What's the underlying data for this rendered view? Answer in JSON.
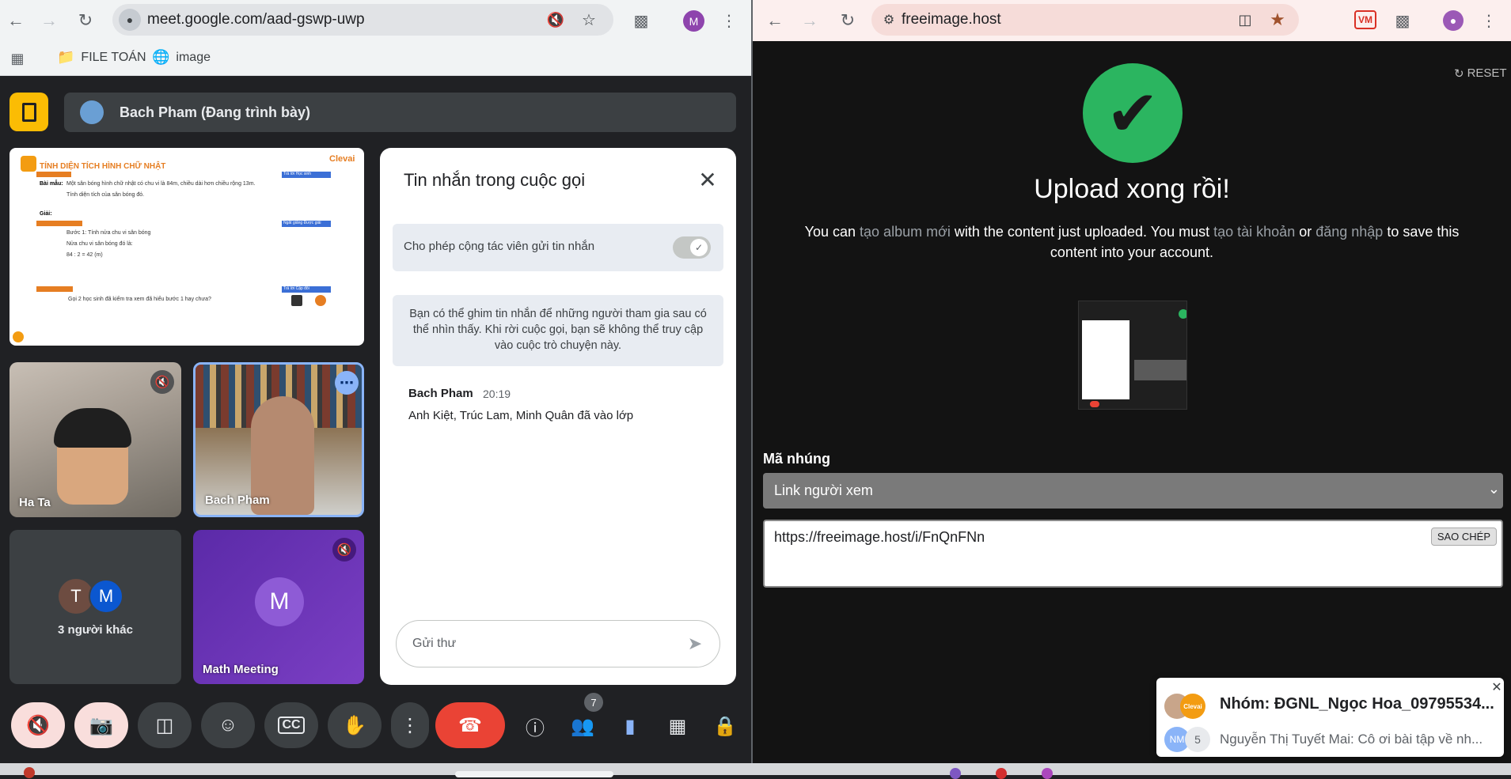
{
  "left_browser": {
    "url": "meet.google.com/aad-gswp-uwp",
    "profile_letter": "M",
    "bookmarks": [
      {
        "label": "FILE TOÁN",
        "icon": "folder-icon"
      },
      {
        "label": "image",
        "icon": "globe-icon"
      }
    ]
  },
  "meet": {
    "presenter_label": "Bach Pham (Đang trình bày)",
    "slide": {
      "brand": "Clevai",
      "title": "TÍNH DIỆN TÍCH HÌNH CHỮ NHẬT",
      "tag1": "Bài mẫu:",
      "text1": "Một sân bóng hình chữ nhật có chu vi là 84m, chiều dài hơn chiều rộng 13m.",
      "text1b": "Tính diện tích của sân bóng đó.",
      "label_solve": "Giải:",
      "step1": "Bước 1: Tính nửa chu vi sân bóng",
      "step2": "Nửa chu vi sân bóng đó là:",
      "step3": "84 : 2 = 42 (m)",
      "question": "Gọi 2 học sinh đã kiểm tra xem đã hiểu bước 1 hay chưa?",
      "side1": "Trả lời Học sinh",
      "side2": "Ngắt giảng Được giải",
      "side3": "Trả lời Cặp đôi"
    },
    "tiles": [
      {
        "name": "Ha Ta"
      },
      {
        "name": "Bach Pham"
      },
      {
        "name": "3 người khác",
        "initials": [
          "T",
          "M"
        ]
      },
      {
        "name": "Math Meeting",
        "initial": "M"
      }
    ],
    "chat": {
      "title": "Tin nhắn trong cuộc gọi",
      "toggle_label": "Cho phép cộng tác viên gửi tin nhắn",
      "info": "Bạn có thể ghim tin nhắn để những người tham gia sau có thể nhìn thấy. Khi rời cuộc gọi, bạn sẽ không thể truy cập vào cuộc trò chuyện này.",
      "message_sender": "Bach Pham",
      "message_time": "20:19",
      "message_text": "Anh Kiệt, Trúc Lam, Minh Quân đã vào lớp",
      "input_placeholder": "Gửi thư"
    },
    "participants_badge": "7"
  },
  "right_browser": {
    "url": "freeimage.host",
    "reset_label": "RESET",
    "upload_title": "Upload xong rồi!",
    "desc_before": "You can ",
    "desc_link1": "tạo album mới",
    "desc_mid1": " with the content just uploaded. You must ",
    "desc_link2": "tạo tài khoản",
    "desc_mid2": " or ",
    "desc_link3": "đăng nhập",
    "desc_after1": " to save this",
    "desc_after2": "content into your account.",
    "embed_label": "Mã nhúng",
    "select_value": "Link người xem",
    "embed_value": "https://freeimage.host/i/FnQnFNn",
    "copy_label": "SAO CHÉP"
  },
  "notification": {
    "title": "Nhóm: ĐGNL_Ngọc Hoa_09795534...",
    "body": "Nguyễn Thị Tuyết Mai: Cô ơi bài tập về nh...",
    "avatar_initials": "NM",
    "count": "5",
    "brand": "Clevai"
  },
  "colors": {
    "meet_bg": "#202124",
    "end_call": "#ea4335",
    "check_green": "#2bb560",
    "chat_accent": "#8ab4f8"
  }
}
